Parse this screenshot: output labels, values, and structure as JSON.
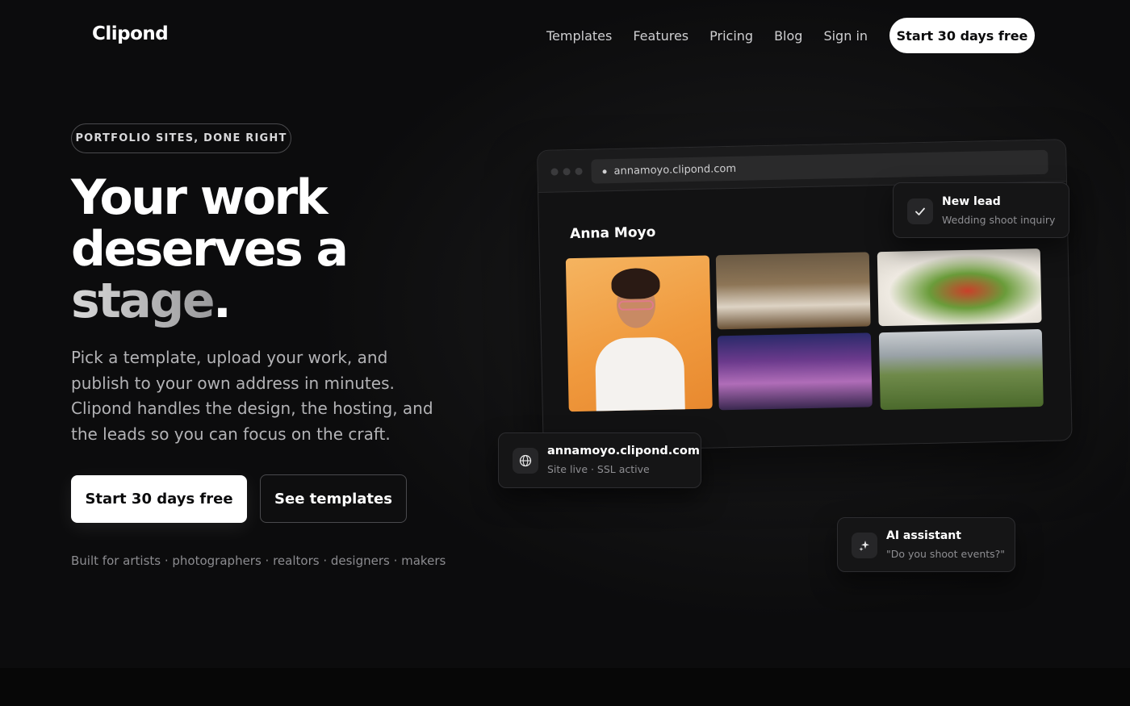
{
  "brand": {
    "name": "Clipond"
  },
  "nav": {
    "links": [
      "Templates",
      "Features",
      "Pricing",
      "Blog",
      "Sign in"
    ],
    "cta": "Start 30 days free"
  },
  "hero": {
    "eyebrow": "PORTFOLIO SITES, DONE RIGHT",
    "headline_line1": "Your work",
    "headline_line2": "deserves a",
    "headline_line3": "stage",
    "headline_period": ".",
    "lede": "Pick a template, upload your work, and publish to your own address in minutes. Clipond handles the design, the hosting, and the leads so you can focus on the craft.",
    "primary_cta": "Start 30 days free",
    "secondary_cta": "See templates",
    "built_for": "Built for artists · photographers · realtors · designers · makers"
  },
  "mockup": {
    "url": "annamoyo.clipond.com",
    "site_title": "Anna Moyo"
  },
  "cards": {
    "lead": {
      "icon": "check-icon",
      "title": "New lead",
      "subtitle": "Wedding shoot inquiry"
    },
    "site": {
      "icon": "globe-icon",
      "title": "annamoyo.clipond.com",
      "subtitle": "Site live · SSL active"
    },
    "ai": {
      "icon": "sparkle-icon",
      "title": "AI assistant",
      "subtitle": "\"Do you shoot events?\""
    }
  },
  "colors": {
    "background": "#0b0b0c",
    "primary_button": "#ffffff",
    "text": "#ffffff"
  }
}
